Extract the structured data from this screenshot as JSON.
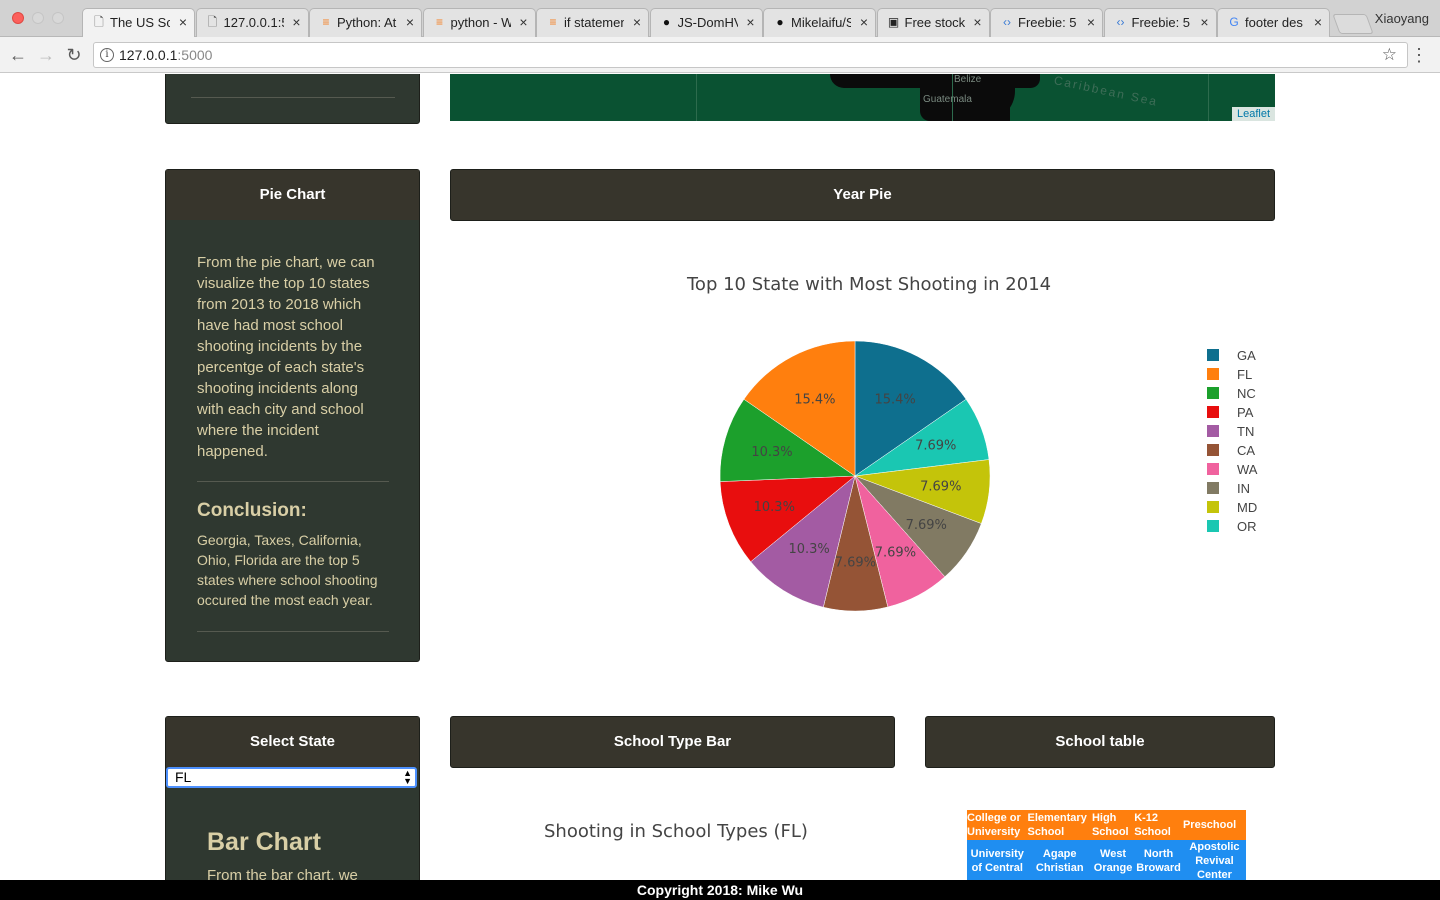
{
  "browser": {
    "tabs": [
      {
        "title": "The US Sc",
        "icon": "page-icon",
        "active": true
      },
      {
        "title": "127.0.0.1:5",
        "icon": "page-icon",
        "active": false
      },
      {
        "title": "Python: At",
        "icon": "stackoverflow-icon",
        "active": false
      },
      {
        "title": "python - W",
        "icon": "stackoverflow-icon",
        "active": false
      },
      {
        "title": "if statemen",
        "icon": "stackoverflow-icon",
        "active": false
      },
      {
        "title": "JS-DomHV",
        "icon": "github-icon",
        "active": false
      },
      {
        "title": "Mikelaifu/S",
        "icon": "github-icon",
        "active": false
      },
      {
        "title": "Free stock",
        "icon": "camera-icon",
        "active": false
      },
      {
        "title": "Freebie: 5",
        "icon": "code-icon",
        "active": false
      },
      {
        "title": "Freebie: 5",
        "icon": "code-icon",
        "active": false
      },
      {
        "title": "footer des",
        "icon": "google-icon",
        "active": false
      }
    ],
    "profile_name": "Xiaoyang",
    "url_host": "127.0.0.1",
    "url_port": ":5000"
  },
  "map": {
    "labels": [
      "Belize",
      "Guatemala",
      "Caribbean Sea"
    ],
    "attribution": "Leaflet"
  },
  "pie_panel": {
    "title": "Pie Chart",
    "description": "From the pie chart, we can visualize the top 10 states from 2013 to 2018 which have had most school shooting incidents by the percentge of each state's shooting incidents along with each city and school where the incident happened.",
    "conclusion_title": "Conclusion:",
    "conclusion_text": "Georgia, Taxes, California, Ohio, Florida are the top 5 states where school shooting occured the most each year."
  },
  "year_pie_header": "Year Pie",
  "chart_data": {
    "type": "pie",
    "title": "Top 10 State with Most Shooting in 2014",
    "labels": [
      "GA",
      "FL",
      "NC",
      "PA",
      "TN",
      "CA",
      "WA",
      "IN",
      "MD",
      "OR"
    ],
    "values": [
      15.4,
      15.4,
      10.3,
      10.3,
      10.3,
      7.69,
      7.69,
      7.69,
      7.69,
      7.69
    ],
    "slice_text": [
      "15.4%",
      "15.4%",
      "10.3%",
      "10.3%",
      "10.3%",
      "7.69%",
      "7.69%",
      "7.69%",
      "7.69%",
      "7.69%"
    ],
    "colors": {
      "GA": "#0e6f8e",
      "FL": "#ff7f0e",
      "NC": "#1ca02c",
      "PA": "#e80e0e",
      "TN": "#a35ba3",
      "CA": "#955436",
      "WA": "#f0629e",
      "IN": "#817a63",
      "MD": "#c4c40a",
      "OR": "#1ac7b2"
    },
    "slice_order": [
      "GA",
      "OR",
      "MD",
      "IN",
      "WA",
      "CA",
      "TN",
      "PA",
      "NC",
      "FL"
    ],
    "legend": "right"
  },
  "select_state_panel": {
    "title": "Select State",
    "selected": "FL",
    "bar_chart_heading": "Bar Chart",
    "bar_chart_text": "From the bar chart, we"
  },
  "school_type_bar": {
    "header": "School Type Bar",
    "chart_title": "Shooting in School Types (FL)"
  },
  "school_table": {
    "header": "School table",
    "columns": [
      "College or University",
      "Elementary School",
      "High School",
      "K-12 School",
      "Preschool"
    ],
    "rows": [
      [
        "University of Central",
        "Agape Christian",
        "West Orange",
        "North Broward",
        "Apostolic Revival Center"
      ]
    ]
  },
  "footer": "Copyright 2018: Mike Wu"
}
